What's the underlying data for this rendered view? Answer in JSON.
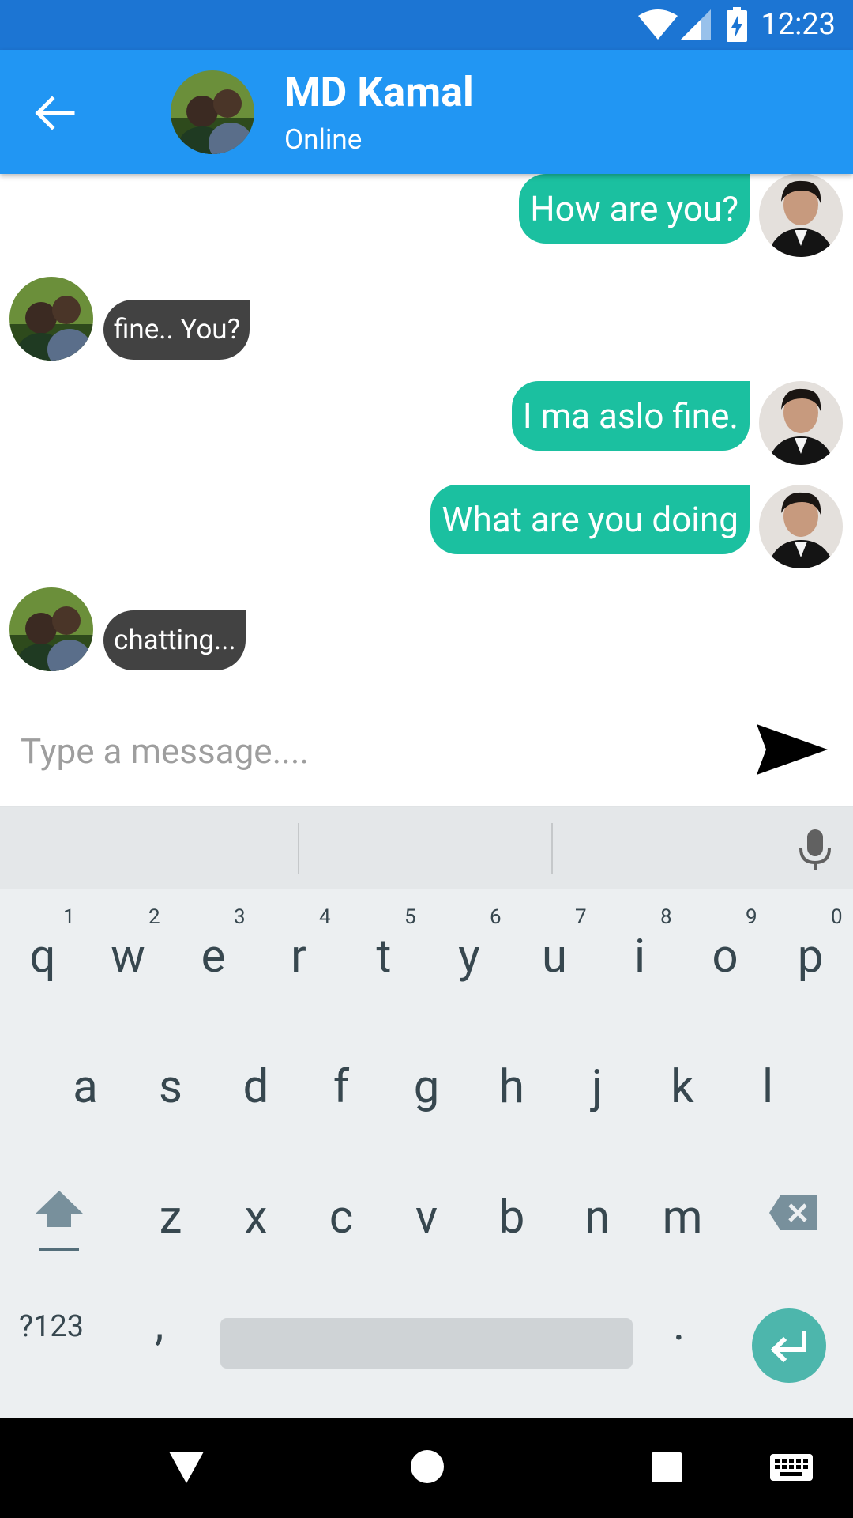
{
  "status_bar": {
    "time": "12:23",
    "icons": [
      "wifi-icon",
      "signal-icon",
      "battery-charging-icon"
    ]
  },
  "header": {
    "contact_name": "MD Kamal",
    "status": "Online",
    "back_icon": "arrow-back-icon"
  },
  "messages": [
    {
      "direction": "sent",
      "text": "How are you?"
    },
    {
      "direction": "received",
      "text": "fine.. You?"
    },
    {
      "direction": "sent",
      "text": "I ma aslo fine."
    },
    {
      "direction": "sent",
      "text": "What are you doing"
    },
    {
      "direction": "received",
      "text": "chatting..."
    }
  ],
  "composer": {
    "placeholder": "Type a message....",
    "send_icon": "send-icon"
  },
  "keyboard": {
    "row1": [
      {
        "key": "q",
        "hint": "1"
      },
      {
        "key": "w",
        "hint": "2"
      },
      {
        "key": "e",
        "hint": "3"
      },
      {
        "key": "r",
        "hint": "4"
      },
      {
        "key": "t",
        "hint": "5"
      },
      {
        "key": "y",
        "hint": "6"
      },
      {
        "key": "u",
        "hint": "7"
      },
      {
        "key": "i",
        "hint": "8"
      },
      {
        "key": "o",
        "hint": "9"
      },
      {
        "key": "p",
        "hint": "0"
      }
    ],
    "row2": [
      "a",
      "s",
      "d",
      "f",
      "g",
      "h",
      "j",
      "k",
      "l"
    ],
    "row3": [
      "z",
      "x",
      "c",
      "v",
      "b",
      "n",
      "m"
    ],
    "symbols": "?123",
    "comma": ",",
    "period": "."
  },
  "colors": {
    "status_bar": "#1c75d3",
    "app_bar": "#2196f3",
    "sent_bubble": "#1bc0a0",
    "received_bubble": "#424242",
    "keyboard_bg": "#eceff1",
    "enter_key": "#4db6ac"
  }
}
